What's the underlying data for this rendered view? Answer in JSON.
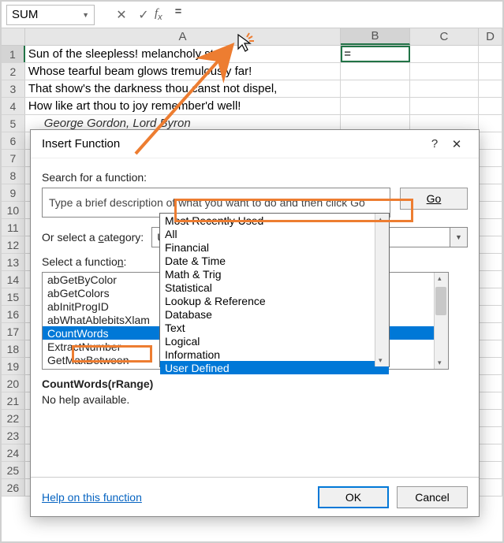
{
  "namebox": "SUM",
  "formula": "=",
  "columns": [
    "A",
    "B",
    "C",
    "D"
  ],
  "rows_count": 26,
  "cells": {
    "A1": "Sun of the sleepless! melancholy star!",
    "A2": "Whose tearful beam glows tremulously far!",
    "A3": "That show's the darkness thou canst not dispel,",
    "A4": "How like art thou to joy remember'd well!",
    "A5": "George Gordon, Lord Byron",
    "B1": "="
  },
  "active_cell": "B1",
  "dialog": {
    "title": "Insert Function",
    "search_label": "Search for a function:",
    "search_placeholder": "Type a brief description of what you want to do and then click Go",
    "go_label": "Go",
    "category_label_pre": "Or select a ",
    "category_label_u": "c",
    "category_label_post": "ategory:",
    "category_value": "User Defined",
    "select_label": "Select a functio",
    "select_label_u": "n",
    "select_label_post": ":",
    "functions": [
      "abGetByColor",
      "abGetColors",
      "abInitProgID",
      "abWhatAblebitsXlam",
      "CountWords",
      "ExtractNumber",
      "GetMaxBetween"
    ],
    "selected_function": "CountWords",
    "signature": "CountWords(rRange)",
    "no_help": "No help available.",
    "help_link": "Help on this function",
    "ok": "OK",
    "cancel": "Cancel",
    "dropdown_options": [
      "Most Recently Used",
      "All",
      "Financial",
      "Date & Time",
      "Math & Trig",
      "Statistical",
      "Lookup & Reference",
      "Database",
      "Text",
      "Logical",
      "Information",
      "User Defined"
    ],
    "dropdown_selected": "User Defined"
  }
}
